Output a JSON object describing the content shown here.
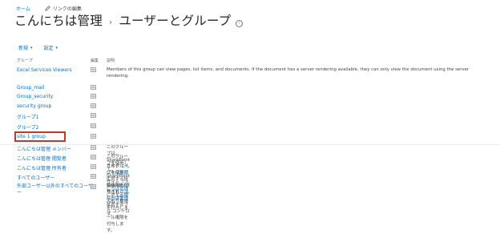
{
  "breadcrumb": {
    "home": "ホーム",
    "edit_links": "リンクの編集"
  },
  "title": {
    "site": "こんにちは管理",
    "page": "ユーザーとグループ"
  },
  "toolbar": {
    "new_label": "新規",
    "settings_label": "設定"
  },
  "columns": {
    "group": "グループ",
    "edit": "編集",
    "description": "説明"
  },
  "groups": [
    {
      "name": "Excel Services Viewers",
      "desc_line1": "Members of this group can view pages, list items, and documents. If the document has a server rendering available, they can only view the document using the server",
      "desc_line2": "rendering."
    },
    {
      "name": "Group_mail"
    },
    {
      "name": "Group_security"
    },
    {
      "name": "security group"
    },
    {
      "name": "グループ1"
    },
    {
      "name": "グループ2"
    },
    {
      "name": "site 1 group"
    },
    {
      "name": "こんにちは管理 メンバー",
      "desc_pre": "このグループは、SharePoint サイト ",
      "desc_link": "こんにちは管理",
      "desc_post": " に対する投稿権限を付与されたグループです。"
    },
    {
      "name": "こんにちは管理 閲覧者",
      "desc_pre": "このグループを使用して、SharePoint サイト ",
      "desc_link": "こんにちは管理",
      "desc_post": " に対する読み取り権限を付与します。"
    },
    {
      "name": "こんにちは管理 所有者",
      "desc_pre": "このグループを使用して、SharePoint サイト ",
      "desc_link": "こんにちは管理",
      "desc_post": " に対するフル コントロール権限を付与します。"
    },
    {
      "name": "すべてのユーザー"
    },
    {
      "name": "外部ユーザー以外のすべてのユーザ",
      "name_line2": "ー"
    }
  ]
}
